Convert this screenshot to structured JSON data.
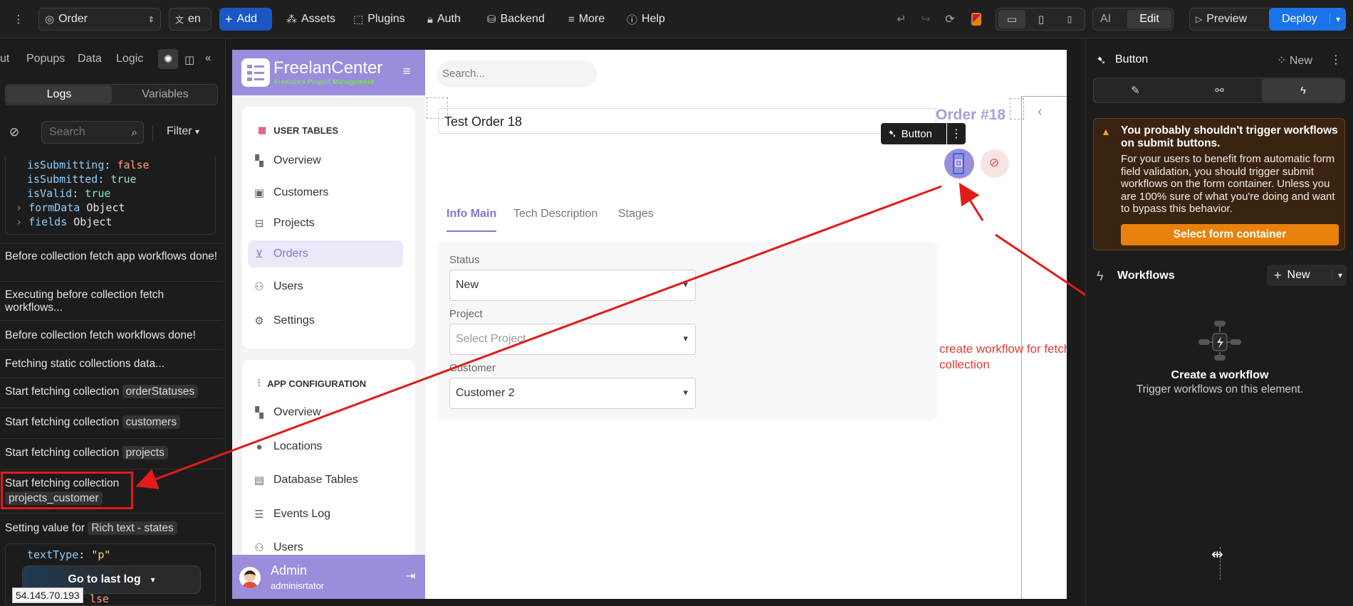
{
  "topbar": {
    "page_select": "Order",
    "lang": "en",
    "add": "Add",
    "assets": "Assets",
    "plugins": "Plugins",
    "auth": "Auth",
    "backend": "Backend",
    "more": "More",
    "help": "Help",
    "ai": "AI",
    "edit": "Edit",
    "preview": "Preview",
    "deploy": "Deploy"
  },
  "left_panel": {
    "tabs": [
      "ut",
      "Popups",
      "Data",
      "Logic"
    ],
    "subtabs": {
      "logs": "Logs",
      "variables": "Variables"
    },
    "search_placeholder": "Search",
    "filter": "Filter",
    "state_block": [
      {
        "key": "isSubmitting",
        "value": "false"
      },
      {
        "key": "isSubmitted",
        "value": "true"
      },
      {
        "key": "isValid",
        "value": "true"
      },
      {
        "key": "formData",
        "value": "Object"
      },
      {
        "key": "fields",
        "value": "Object"
      }
    ],
    "logs": [
      "Before collection fetch app workflows done!",
      "Executing before collection fetch workflows...",
      "Before collection fetch workflows done!",
      "Fetching static collections data...",
      "Start fetching collection",
      "orderStatuses",
      "customers",
      "projects",
      "projects_customer",
      "Setting value for",
      "Rich text - states"
    ],
    "code_bottom": {
      "key": "textType",
      "value": "\"p\"",
      "partial": "lse"
    },
    "go_last_log": "Go to last log",
    "ip": "54.145.70.193"
  },
  "app": {
    "brand": "FreelanCenter",
    "brand_sub": "Freelance Project Management",
    "search_placeholder": "Search...",
    "section_user_tables": "USER TABLES",
    "user_tables": [
      "Overview",
      "Customers",
      "Projects",
      "Orders",
      "Users",
      "Settings"
    ],
    "section_app_config": "APP CONFIGURATION",
    "app_config": [
      "Overview",
      "Locations",
      "Database Tables",
      "Events Log",
      "Users"
    ],
    "admin_name": "Admin",
    "admin_role": "adminisrtator",
    "order_title": "Test Order 18",
    "order_number": "Order #18",
    "button_badge": "Button",
    "tabs": [
      "Info Main",
      "Tech Description",
      "Stages"
    ],
    "status_label": "Status",
    "status_value": "New",
    "project_label": "Project",
    "project_placeholder": "Select Project",
    "customer_label": "Customer",
    "customer_value": "Customer 2"
  },
  "annotation": {
    "text": "create workflow for fetching a specific collection",
    "color": "#e53935"
  },
  "right_panel": {
    "title": "Button",
    "new": "New",
    "warning_title": "You probably shouldn't trigger workflows on submit buttons.",
    "warning_body": "For your users to benefit from automatic form field validation, you should trigger submit workflows on the form container. Unless you are 100% sure of what you're doing and want to bypass this behavior.",
    "select_form_container": "Select form container",
    "workflows": "Workflows",
    "workflows_new": "New",
    "create_workflow": "Create a workflow",
    "create_workflow_sub": "Trigger workflows on this element."
  },
  "colors": {
    "accent": "#1a73e8",
    "brand": "#9b8ddb",
    "warning": "#e8820c"
  }
}
